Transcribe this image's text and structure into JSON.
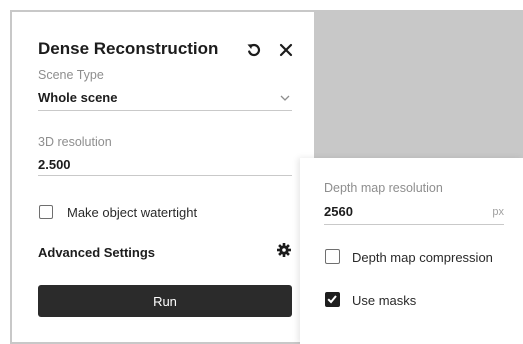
{
  "panel": {
    "title": "Dense Reconstruction",
    "reset_icon": "undo-icon",
    "close_icon": "close-icon",
    "scene_type": {
      "label": "Scene Type",
      "value": "Whole scene",
      "icon": "chevron-down-icon"
    },
    "resolution": {
      "label": "3D resolution",
      "value": "2.500"
    },
    "watertight": {
      "label": "Make object watertight",
      "checked": false
    },
    "advanced": {
      "label": "Advanced Settings",
      "icon": "gear-icon"
    },
    "run_label": "Run"
  },
  "advanced_popup": {
    "depth_resolution": {
      "label": "Depth map resolution",
      "value": "2560",
      "unit": "px"
    },
    "compression": {
      "label": "Depth map compression",
      "checked": false
    },
    "masks": {
      "label": "Use masks",
      "checked": true
    }
  },
  "colors": {
    "backdrop": "#c8c8c8",
    "button": "#2b2b2b",
    "text": "#1c1c1c",
    "muted": "#8e8e8e"
  }
}
